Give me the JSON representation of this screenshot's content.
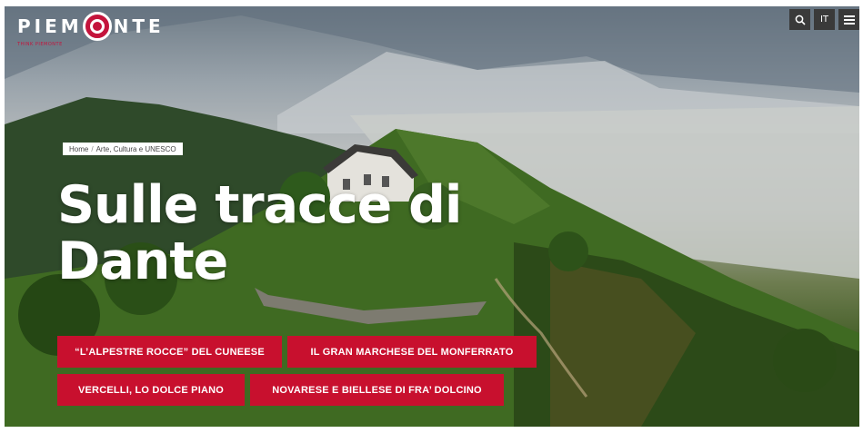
{
  "logo": {
    "text_left": "PIEM",
    "text_right": "NTE",
    "tagline": "THINK PIEMONTE"
  },
  "top_buttons": {
    "search_icon": "search-icon",
    "language": "IT",
    "menu_icon": "hamburger-menu-icon"
  },
  "breadcrumb": {
    "home": "Home",
    "separator": "/",
    "current": "Arte, Cultura e UNESCO"
  },
  "hero": {
    "title_line1": "Sulle tracce di",
    "title_line2": "Dante"
  },
  "chips": [
    {
      "label": "“L’ALPESTRE ROCCE” DEL CUNEESE"
    },
    {
      "label": "IL GRAN MARCHESE DEL MONFERRATO"
    },
    {
      "label": "VERCELLI, LO DOLCE PIANO"
    },
    {
      "label": "NOVARESE E BIELLESE DI FRA’ DOLCINO"
    }
  ],
  "colors": {
    "accent": "#c8102e",
    "button_dark": "#3a3a3a"
  }
}
